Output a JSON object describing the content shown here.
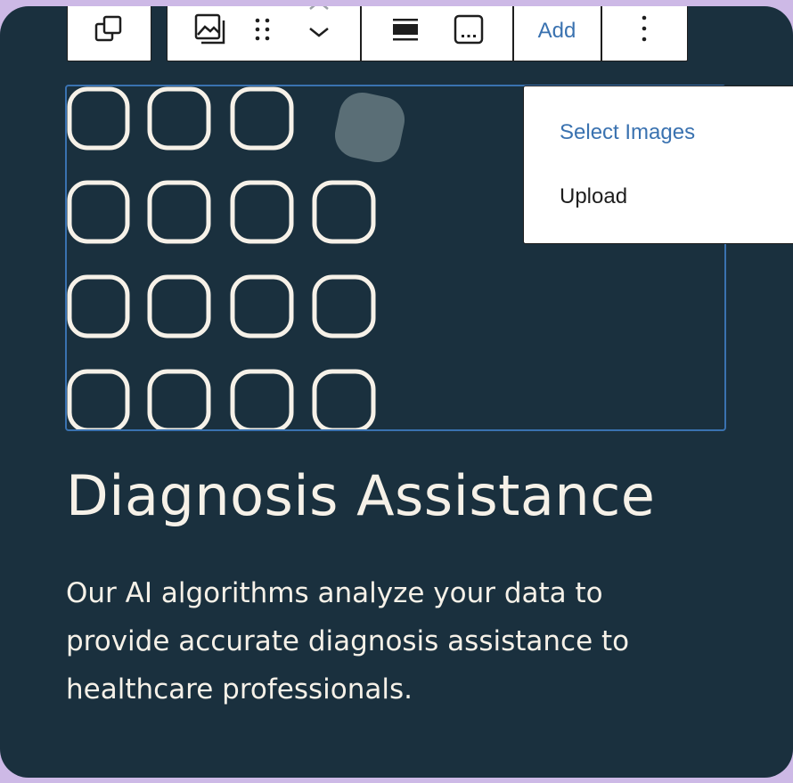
{
  "toolbar": {
    "add_label": "Add"
  },
  "dropdown": {
    "items": [
      {
        "label": "Select Images",
        "color": "#3a72b0"
      },
      {
        "label": "Upload",
        "color": "#1e1e1e"
      }
    ]
  },
  "content": {
    "heading": "Diagnosis Assistance",
    "paragraph": "Our AI algorithms analyze your data to provide accurate diagnosis assistance to healthcare professionals."
  },
  "colors": {
    "card_background": "#1a303e",
    "page_background": "#cdb9e6",
    "accent": "#3a72b0",
    "text": "#f6f1e8"
  }
}
